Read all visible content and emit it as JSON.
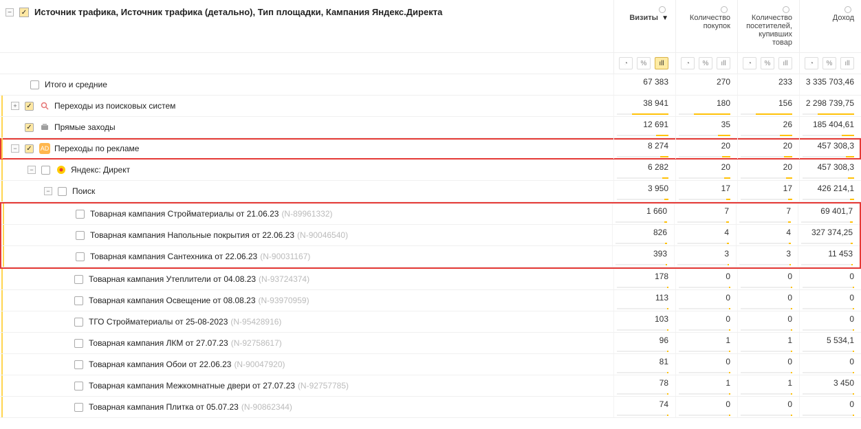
{
  "header": {
    "title": "Источник трафика, Источник трафика (детально), Тип площадки, Кампания Яндекс.Директа",
    "columns": [
      {
        "label": "Визиты",
        "sorted": true
      },
      {
        "label": "Количество покупок",
        "sorted": false
      },
      {
        "label": "Количество посетителей, купивших товар",
        "sorted": false
      },
      {
        "label": "Доход",
        "sorted": false
      }
    ],
    "sort_marker": "▼"
  },
  "icons": {
    "pie": "◔",
    "percent": "%",
    "bars": "ıll"
  },
  "totals_label": "Итого и средние",
  "totals": {
    "visits": "67 383",
    "purchases": "270",
    "buyers": "233",
    "revenue": "3 335 703,46"
  },
  "rows": [
    {
      "id": "search",
      "indent": 1,
      "expand": "+",
      "checked": true,
      "icon": "search",
      "label": "Переходы из поисковых систем",
      "code": "",
      "visits": "38 941",
      "purchases": "180",
      "buyers": "156",
      "revenue": "2 298 739,75",
      "bar": 60,
      "hl": false
    },
    {
      "id": "direct_visits",
      "indent": 1,
      "expand": "",
      "checked": true,
      "icon": "cube",
      "label": "Прямые заходы",
      "code": "",
      "visits": "12 691",
      "purchases": "35",
      "buyers": "26",
      "revenue": "185 404,61",
      "bar": 20,
      "hl": false
    },
    {
      "id": "ads",
      "indent": 1,
      "expand": "-",
      "checked": true,
      "icon": "ad",
      "label": "Переходы по рекламе",
      "code": "",
      "visits": "8 274",
      "purchases": "20",
      "buyers": "20",
      "revenue": "457 308,3",
      "bar": 13,
      "hl": true
    },
    {
      "id": "yadirect",
      "indent": 2,
      "expand": "-",
      "checked": false,
      "icon": "direct",
      "label": "Яндекс: Директ",
      "code": "",
      "visits": "6 282",
      "purchases": "20",
      "buyers": "20",
      "revenue": "457 308,3",
      "bar": 10,
      "hl": false
    },
    {
      "id": "poisk",
      "indent": 3,
      "expand": "-",
      "checked": false,
      "icon": "",
      "label": "Поиск",
      "code": "",
      "visits": "3 950",
      "purchases": "17",
      "buyers": "17",
      "revenue": "426 214,1",
      "bar": 7,
      "hl": false
    },
    {
      "id": "c1",
      "indent": 4,
      "expand": "",
      "checked": false,
      "icon": "",
      "label": "Товарная кампания Стройматериалы от 21.06.23",
      "code": "(N-89961332)",
      "visits": "1 660",
      "purchases": "7",
      "buyers": "7",
      "revenue": "69 401,7",
      "bar": 4,
      "hl": false
    },
    {
      "id": "c2",
      "indent": 4,
      "expand": "",
      "checked": false,
      "icon": "",
      "label": "Товарная кампания Напольные покрытия от 22.06.23",
      "code": "(N-90046540)",
      "visits": "826",
      "purchases": "4",
      "buyers": "4",
      "revenue": "327 374,25",
      "bar": 3,
      "hl": false
    },
    {
      "id": "c3",
      "indent": 4,
      "expand": "",
      "checked": false,
      "icon": "",
      "label": "Товарная кампания Сантехника от 22.06.23",
      "code": "(N-90031167)",
      "visits": "393",
      "purchases": "3",
      "buyers": "3",
      "revenue": "11 453",
      "bar": 2,
      "hl": false
    },
    {
      "id": "c4",
      "indent": 4,
      "expand": "",
      "checked": false,
      "icon": "",
      "label": "Товарная кампания Утеплители от 04.08.23",
      "code": "(N-93724374)",
      "visits": "178",
      "purchases": "0",
      "buyers": "0",
      "revenue": "0",
      "bar": 1,
      "hl": false
    },
    {
      "id": "c5",
      "indent": 4,
      "expand": "",
      "checked": false,
      "icon": "",
      "label": "Товарная кампания Освещение от 08.08.23",
      "code": "(N-93970959)",
      "visits": "113",
      "purchases": "0",
      "buyers": "0",
      "revenue": "0",
      "bar": 1,
      "hl": false
    },
    {
      "id": "c6",
      "indent": 4,
      "expand": "",
      "checked": false,
      "icon": "",
      "label": "ТГО Стройматериалы от 25-08-2023",
      "code": "(N-95428916)",
      "visits": "103",
      "purchases": "0",
      "buyers": "0",
      "revenue": "0",
      "bar": 1,
      "hl": false
    },
    {
      "id": "c7",
      "indent": 4,
      "expand": "",
      "checked": false,
      "icon": "",
      "label": "Товарная кампания ЛКМ от 27.07.23",
      "code": "(N-92758617)",
      "visits": "96",
      "purchases": "1",
      "buyers": "1",
      "revenue": "5 534,1",
      "bar": 1,
      "hl": false
    },
    {
      "id": "c8",
      "indent": 4,
      "expand": "",
      "checked": false,
      "icon": "",
      "label": "Товарная кампания Обои от 22.06.23",
      "code": "(N-90047920)",
      "visits": "81",
      "purchases": "0",
      "buyers": "0",
      "revenue": "0",
      "bar": 1,
      "hl": false
    },
    {
      "id": "c9",
      "indent": 4,
      "expand": "",
      "checked": false,
      "icon": "",
      "label": "Товарная кампания Межкомнатные двери от 27.07.23",
      "code": "(N-92757785)",
      "visits": "78",
      "purchases": "1",
      "buyers": "1",
      "revenue": "3 450",
      "bar": 1,
      "hl": false
    },
    {
      "id": "c10",
      "indent": 4,
      "expand": "",
      "checked": false,
      "icon": "",
      "label": "Товарная кампания Плитка от 05.07.23",
      "code": "(N-90862344)",
      "visits": "74",
      "purchases": "0",
      "buyers": "0",
      "revenue": "0",
      "bar": 1,
      "hl": false
    }
  ],
  "highlight_block": {
    "start": "c1",
    "end": "c3"
  }
}
